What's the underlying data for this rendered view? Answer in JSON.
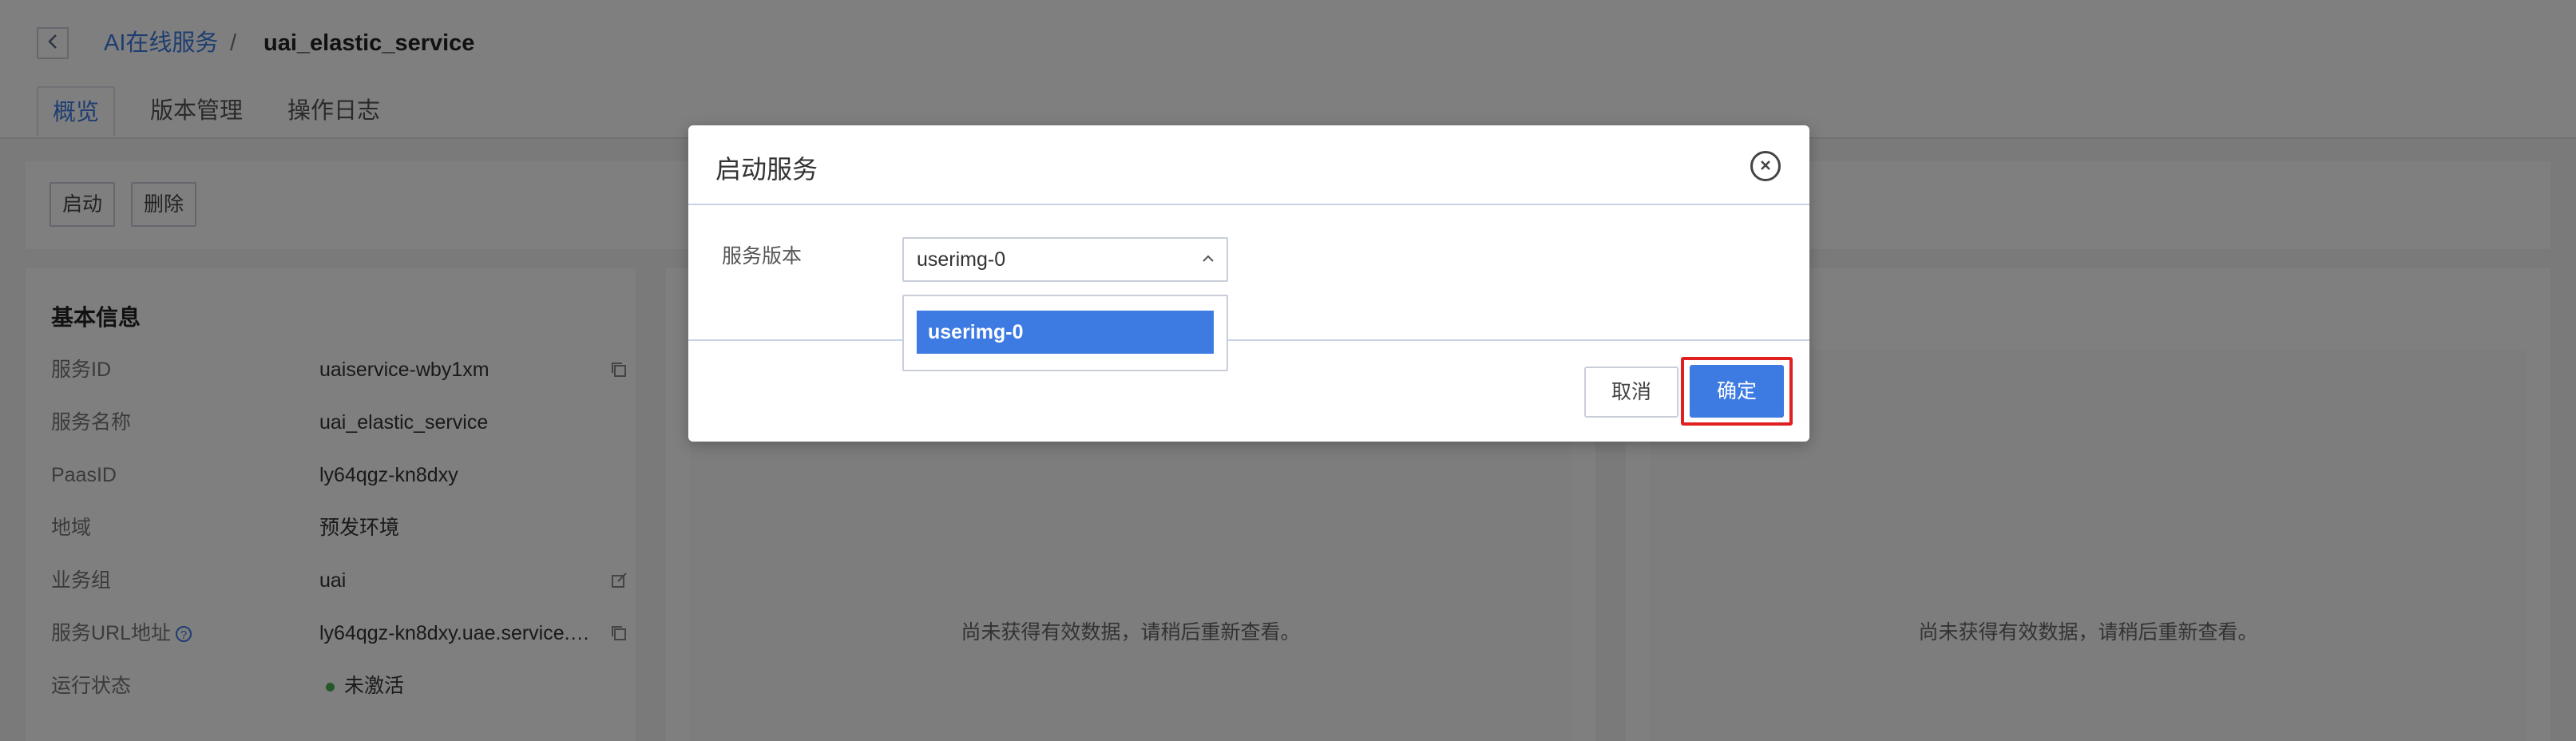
{
  "breadcrumb": {
    "parent": "AI在线服务",
    "separator": "/",
    "current": "uai_elastic_service"
  },
  "tabs": [
    "概览",
    "版本管理",
    "操作日志"
  ],
  "toolbar": {
    "start_label": "启动",
    "delete_label": "删除"
  },
  "info": {
    "title": "基本信息",
    "rows": [
      {
        "label": "服务ID",
        "value": "uaiservice-wby1xm",
        "icon": "copy-icon"
      },
      {
        "label": "服务名称",
        "value": "uai_elastic_service"
      },
      {
        "label": "PaasID",
        "value": "ly64qgz-kn8dxy"
      },
      {
        "label": "地域",
        "value": "预发环境"
      },
      {
        "label": "业务组",
        "value": "uai",
        "icon": "edit-icon"
      },
      {
        "label": "服务URL地址",
        "value": "ly64qgz-kn8dxy.uae.service.…",
        "icon": "copy-icon",
        "help": "?"
      },
      {
        "label": "运行状态",
        "value": "未激活",
        "status_color": "#4caf50"
      }
    ]
  },
  "charts": {
    "empty_message_1": "尚未获得有效数据，请稍后重新查看。",
    "empty_message_2": "尚未获得有效数据，请稍后重新查看。"
  },
  "modal": {
    "title": "启动服务",
    "field_label": "服务版本",
    "select_value": "userimg-0",
    "options": [
      "userimg-0"
    ],
    "cancel_label": "取消",
    "confirm_label": "确定",
    "close_icon": "close-icon",
    "highlight_color": "#e02020"
  }
}
